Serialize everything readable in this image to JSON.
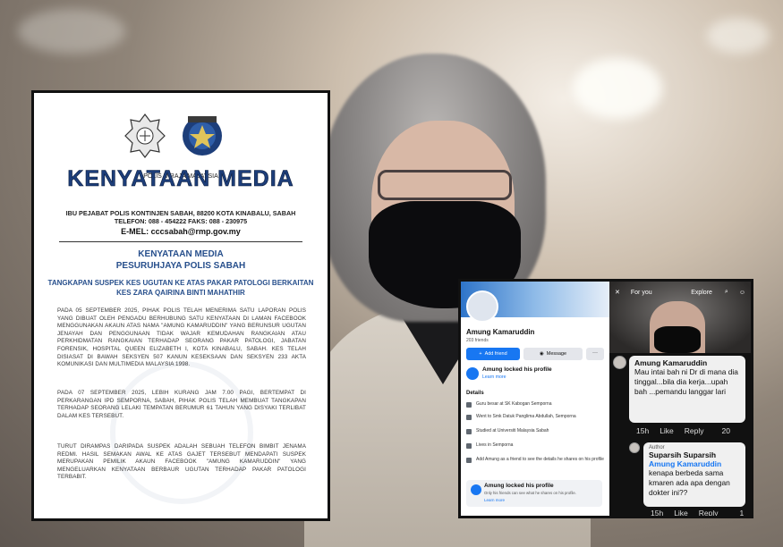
{
  "press": {
    "crest_caption": "POLIS DIRAJA MALAYSIA",
    "title": "KENYATAAN MEDIA",
    "address_line": "IBU PEJABAT POLIS KONTINJEN SABAH, 88200 KOTA KINABALU, SABAH",
    "phone_line": "TELEFON: 088 - 454222   FAKS: 088 - 230975",
    "email_line": "E-MEL: cccsabah@rmp.gov.my",
    "subtitle_1": "KENYATAAN MEDIA",
    "subtitle_2": "PESURUHJAYA POLIS SABAH",
    "headline_1": "TANGKAPAN SUSPEK KES UGUTAN KE ATAS PAKAR PATOLOGI BERKAITAN",
    "headline_2": "KES ZARA QAIRINA BINTI MAHATHIR",
    "para_1": "PADA 05 SEPTEMBER 2025, PIHAK POLIS TELAH MENERIMA SATU LAPORAN POLIS YANG DIBUAT OLEH PENGADU BERHUBUNG SATU KENYATAAN DI LAMAN FACEBOOK MENGGUNAKAN AKAUN ATAS NAMA \"AMUNG KAMARUDDIN\" YANG BERUNSUR UGUTAN JENAYAH DAN PENGGUNAAN TIDAK WAJAR KEMUDAHAN RANGKAIAN ATAU PERKHIDMATAN RANGKAIAN TERHADAP SEORANG PAKAR PATOLOGI, JABATAN FORENSIK, HOSPITAL QUEEN ELIZABETH I, KOTA KINABALU, SABAH. KES TELAH DISIASAT DI BAWAH SEKSYEN 507 KANUN KESEKSAAN DAN SEKSYEN 233 AKTA KOMUNIKASI DAN MULTIMEDIA MALAYSIA 1998.",
    "para_2": "PADA 07 SEPTEMBER 2025, LEBIH KURANG JAM 7.00 PAGI, BERTEMPAT DI PERKARANGAN IPD SEMPORNA, SABAH, PIHAK POLIS TELAH MEMBUAT TANGKAPAN TERHADAP SEORANG LELAKI TEMPATAN BERUMUR 61 TAHUN YANG DISYAKI TERLIBAT DALAM KES TERSEBUT.",
    "para_3": "TURUT DIRAMPAS DARIPADA SUSPEK ADALAH SEBUAH TELEFON BIMBIT JENAMA REDMI. HASIL SEMAKAN AWAL KE ATAS GAJET TERSEBUT MENDAPATI SUSPEK MERUPAKAN PEMILIK AKAUN FACEBOOK \"AMUNG KAMARUDDIN\" YANG MENGELUARKAN KENYATAAN BERBAUR UGUTAN TERHADAP PAKAR PATOLOGI TERBABIT."
  },
  "profile": {
    "name": "Amung Kamaruddin",
    "friends": "203 friends",
    "add_friend": "Add friend",
    "message": "Message",
    "more": "···",
    "locked_title": "Amung locked his profile",
    "locked_link": "Learn more",
    "details_heading": "Details",
    "details": [
      {
        "text": "Guru besar at SK Kabogan Semporna",
        "icon": "briefcase-icon"
      },
      {
        "text": "Went to Smk Datuk Panglima Abdullah, Semporna",
        "icon": "graduation-cap-icon"
      },
      {
        "text": "Studied at Universiti Malaysia Sabah",
        "icon": "graduation-cap-icon"
      },
      {
        "text": "Lives in Semporna",
        "icon": "home-icon"
      },
      {
        "text": "Add Amung as a friend to see the details he shares on his profile",
        "icon": "more-icon"
      }
    ],
    "locked2_title": "Amung locked his profile",
    "locked2_sub": "Only his friends can see what he shares on his profile.",
    "locked2_link": "Learn more"
  },
  "story": {
    "tab_for_you": "For you",
    "tab_explore": "Explore",
    "close": "✕"
  },
  "comments": [
    {
      "name": "Amung Kamaruddin",
      "text": "Mau intai bah ni Dr di mana dia tinggal...bila dia kerja...upah bah ...pemandu langgar lari",
      "time": "15h",
      "like": "Like",
      "reply": "Reply",
      "count": "20"
    },
    {
      "badge": "Author",
      "name": "Suparsih Suparsih",
      "mention": "Amung Kamaruddin",
      "text": "kenapa berbeda sama kmaren ada apa dengan dokter ini??",
      "time": "15h",
      "like": "Like",
      "reply": "Reply",
      "count": "1"
    }
  ]
}
